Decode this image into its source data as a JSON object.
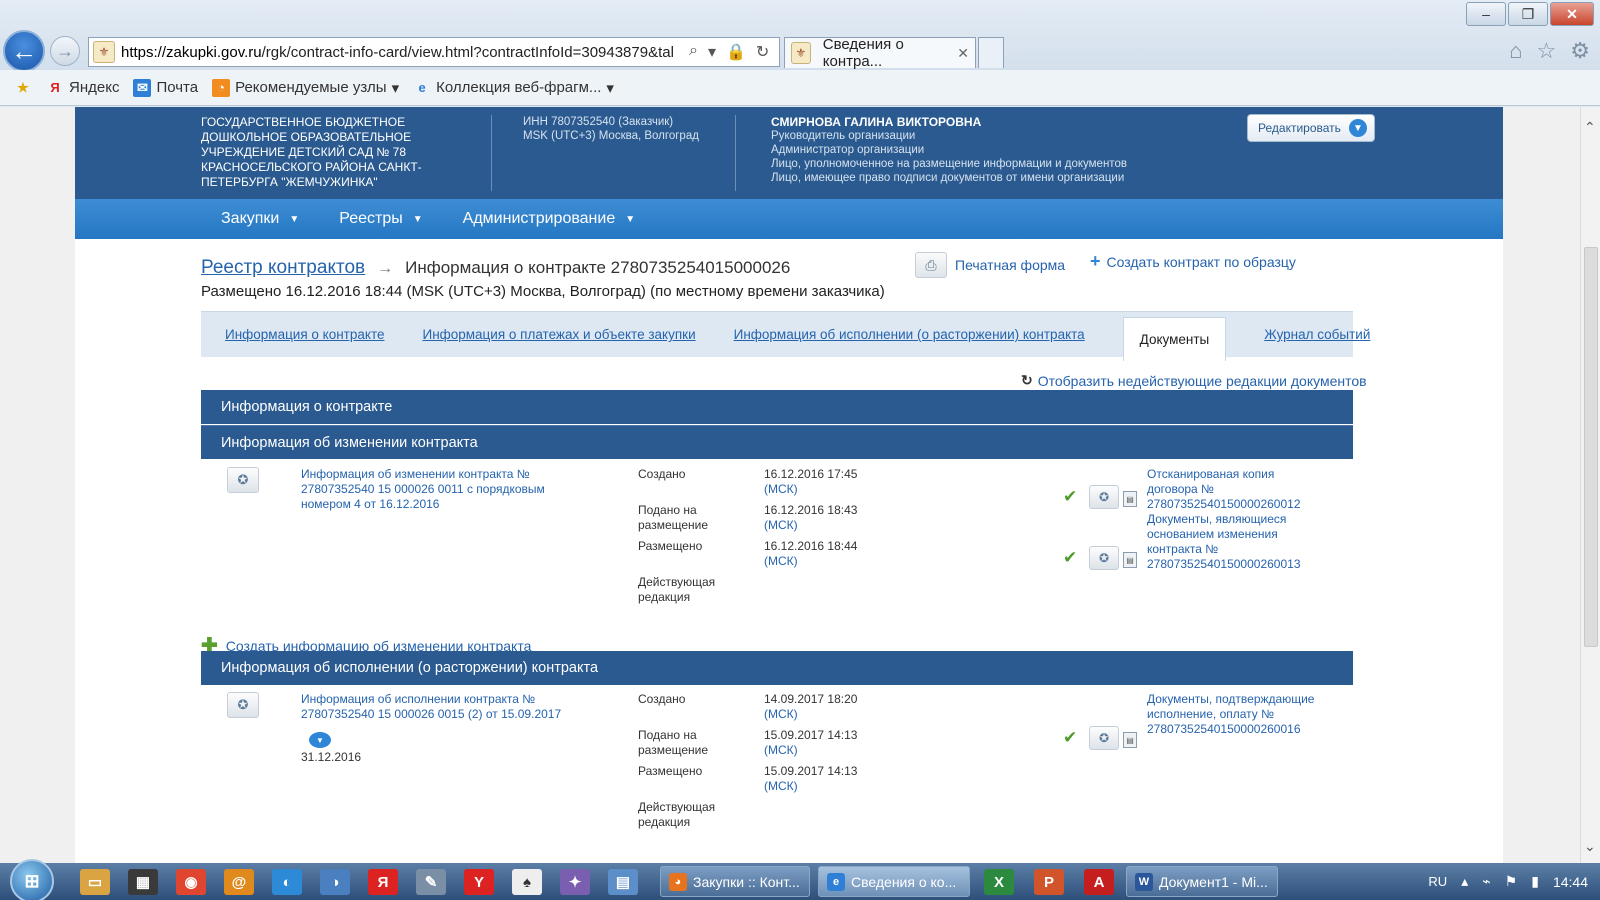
{
  "browser": {
    "url_host": "https://zakupki.gov.ru",
    "url_path": "/rgk/contract-info-card/view.html?contractInfoId=30943879&tal",
    "tab_title": "Сведения о контра...",
    "favorites": [
      {
        "label": "Яндекс"
      },
      {
        "label": "Почта"
      },
      {
        "label": "Рекомендуемые узлы"
      },
      {
        "label": "Коллекция веб-фрагм..."
      }
    ]
  },
  "org": {
    "name": "ГОСУДАРСТВЕННОЕ БЮДЖЕТНОЕ ДОШКОЛЬНОЕ ОБРАЗОВАТЕЛЬНОЕ УЧРЕЖДЕНИЕ ДЕТСКИЙ САД № 78 КРАСНОСЕЛЬСКОГО РАЙОНА САНКТ-ПЕТЕРБУРГА \"ЖЕМЧУЖИНКА\"",
    "inn": "ИНН 7807352540 (Заказчик)",
    "timezone": "MSK (UTC+3) Москва, Волгоград",
    "user_name": "СМИРНОВА ГАЛИНА ВИКТОРОВНА",
    "roles": [
      "Руководитель организации",
      "Администратор организации",
      "Лицо, уполномоченное на размещение информации и документов",
      "Лицо, имеющее право подписи документов от имени организации"
    ],
    "edit_label": "Редактировать"
  },
  "menu": [
    {
      "label": "Закупки"
    },
    {
      "label": "Реестры"
    },
    {
      "label": "Администрирование"
    }
  ],
  "breadcrumb": {
    "registry": "Реестр контрактов",
    "current": "Информация о контракте 2780735254015000026"
  },
  "placed_text": "Размещено 16.12.2016 18:44 (MSK (UTC+3) Москва, Волгоград) (по местному времени заказчика)",
  "actions": {
    "print": "Печатная форма",
    "create_sample": "Создать контракт по образцу",
    "show_inactive": "Отобразить недействующие редакции документов",
    "create_change": "Создать информацию об изменении контракта"
  },
  "tabs": [
    {
      "label": "Информация о контракте"
    },
    {
      "label": "Информация о платежах и объекте закупки"
    },
    {
      "label": "Информация об исполнении (о расторжении) контракта"
    },
    {
      "label": "Документы"
    },
    {
      "label": "Журнал событий"
    }
  ],
  "sections": {
    "contract_info": "Информация о контракте",
    "change_info": "Информация об изменении контракта",
    "execution_info": "Информация об исполнении (о расторжении) контракта"
  },
  "labels": {
    "created": "Создано",
    "submitted": "Подано на размещение",
    "placed": "Размещено",
    "current_edition": "Действующая редакция",
    "msk": "(МСК)"
  },
  "change_record": {
    "title": "Информация об изменении контракта № 27807352540 15 000026 0011 с порядковым номером 4 от 16.12.2016",
    "created": "16.12.2016 17:45",
    "submitted": "16.12.2016 18:43",
    "placed": "16.12.2016 18:44",
    "attachments": [
      "Отсканированая копия договора № 27807352540150000260012",
      "Документы, являющиеся основанием изменения контракта № 27807352540150000260013"
    ]
  },
  "execution_record": {
    "title": "Информация об исполнении контракта № 27807352540 15 000026 0015 (2) от 15.09.2017",
    "end_date": "31.12.2016",
    "created": "14.09.2017 18:20",
    "submitted": "15.09.2017 14:13",
    "placed": "15.09.2017 14:13",
    "attachments": [
      "Документы, подтверждающие исполнение, оплату № 27807352540150000260016"
    ]
  },
  "taskbar": {
    "tasks": [
      {
        "label": "Закупки :: Конт..."
      },
      {
        "label": "Сведения о ко..."
      },
      {
        "label": "Документ1 - Mi..."
      }
    ],
    "lang": "RU",
    "time": "14:44"
  }
}
